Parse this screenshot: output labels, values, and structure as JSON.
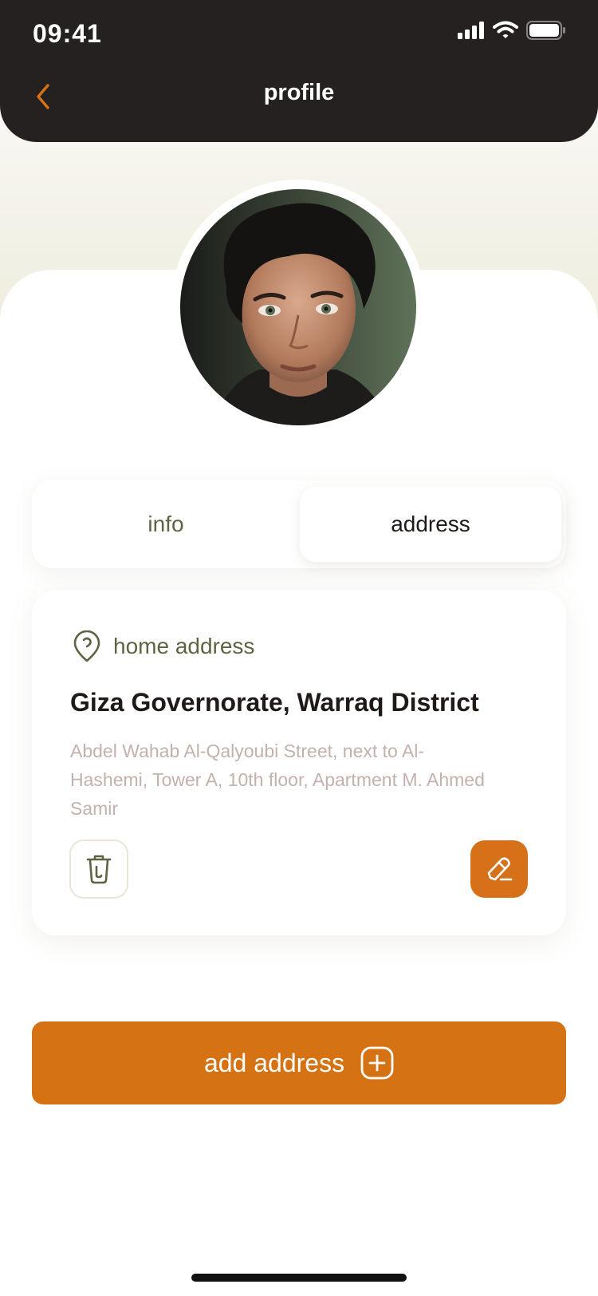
{
  "status_bar": {
    "time": "09:41"
  },
  "header": {
    "title": "profile"
  },
  "tabs": [
    {
      "label": "info",
      "active": false
    },
    {
      "label": "address",
      "active": true
    }
  ],
  "address_card": {
    "label": "home address",
    "title": "Giza Governorate, Warraq District",
    "detail": "Abdel Wahab Al-Qalyoubi Street, next to Al-Hashemi, Tower A, 10th floor, Apartment M. Ahmed Samir"
  },
  "add_button": {
    "label": "add address"
  },
  "colors": {
    "header_bg": "#252120",
    "accent": "#d57214",
    "olive_text": "#5e6343",
    "muted_text": "#c2b1ac"
  },
  "icons": {
    "back": "chevron-left-icon",
    "location": "location-pin-icon",
    "delete": "trash-icon",
    "edit": "pencil-icon",
    "add": "plus-square-icon"
  }
}
